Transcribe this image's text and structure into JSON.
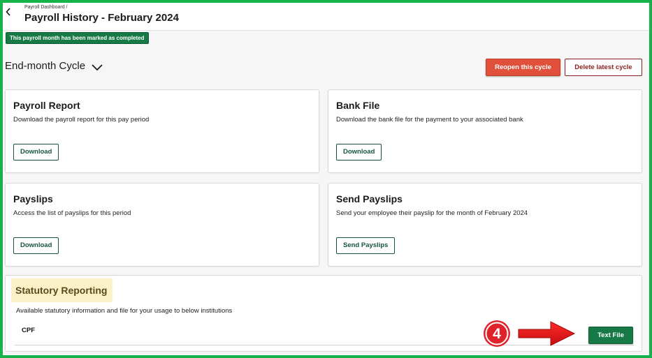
{
  "header": {
    "breadcrumb": "Payroll Dashboard /",
    "title": "Payroll History - February 2024",
    "back_icon": "chevron-left-icon"
  },
  "status": {
    "badge_text": "This payroll month has been marked as completed",
    "color": "#177a46"
  },
  "cycle": {
    "selected": "End-month Cycle",
    "icon": "chevron-down-icon"
  },
  "actions": {
    "reopen_label": "Reopen this cycle",
    "reopen_color": "#e0503a",
    "delete_label": "Delete latest cycle",
    "delete_color": "#8b1f1f"
  },
  "cards": {
    "payroll_report": {
      "title": "Payroll Report",
      "description": "Download the payroll report for this pay period",
      "button": "Download"
    },
    "bank_file": {
      "title": "Bank File",
      "description": "Download the bank file for the payment to your associated bank",
      "button": "Download"
    },
    "payslips": {
      "title": "Payslips",
      "description": "Access the list of payslips for this period",
      "button": "Download"
    },
    "send_payslips": {
      "title": "Send Payslips",
      "description": "Send your employee their payslip for the month of February 2024",
      "button": "Send Payslips"
    }
  },
  "statutory": {
    "title": "Statutory Reporting",
    "description": "Available statutory information and file for your usage to below institutions",
    "rows": [
      {
        "label": "CPF",
        "button": "Text File"
      }
    ]
  },
  "annotation": {
    "step_number": "4",
    "color": "#e0232a",
    "arrow_icon": "right-arrow-icon"
  },
  "colors": {
    "frame": "#16b24a",
    "brand_green": "#14553a"
  }
}
